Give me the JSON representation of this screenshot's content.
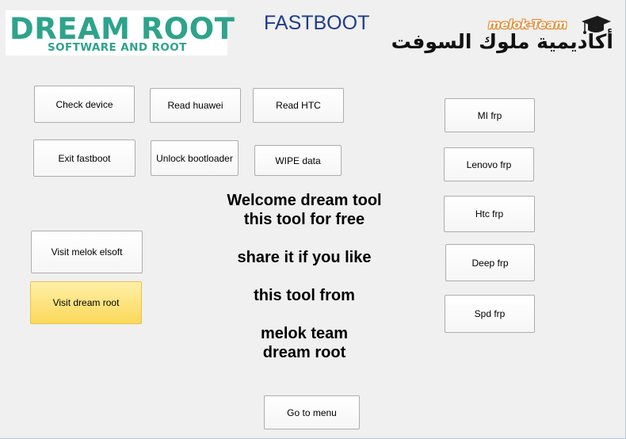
{
  "logo": {
    "main": "DREAM ROOT",
    "sub": "SOFTWARE AND ROOT",
    "color": "#2ea38c"
  },
  "title": "FASTBOOT",
  "brand": {
    "latin": "melok-Team",
    "arabic": "أكاديمية ملوك السوفت",
    "icon": "graduation-cap-icon"
  },
  "buttons": {
    "check_device": "Check device",
    "read_huawei": "Read huawei",
    "read_htc": "Read HTC",
    "exit_fastboot": "Exit fastboot",
    "unlock_bootloader": "Unlock bootloader",
    "wipe_data": "WIPE data",
    "visit_melok": "Visit melok elsoft",
    "visit_dream": "Visit dream root",
    "mi_frp": "MI frp",
    "lenovo_frp": "Lenovo frp",
    "htc_frp": "Htc frp",
    "deep_frp": "Deep frp",
    "spd_frp": "Spd frp",
    "go_to_menu": "Go to menu"
  },
  "welcome": {
    "line1": "Welcome dream tool",
    "line2": "this tool for free",
    "line3": "share it if you like",
    "line4": "this tool from",
    "line5": "melok team",
    "line6": "dream root"
  },
  "colors": {
    "accent_title": "#1f3b8c",
    "highlight_button": "#fbd85a",
    "background": "#f0f0f0"
  }
}
